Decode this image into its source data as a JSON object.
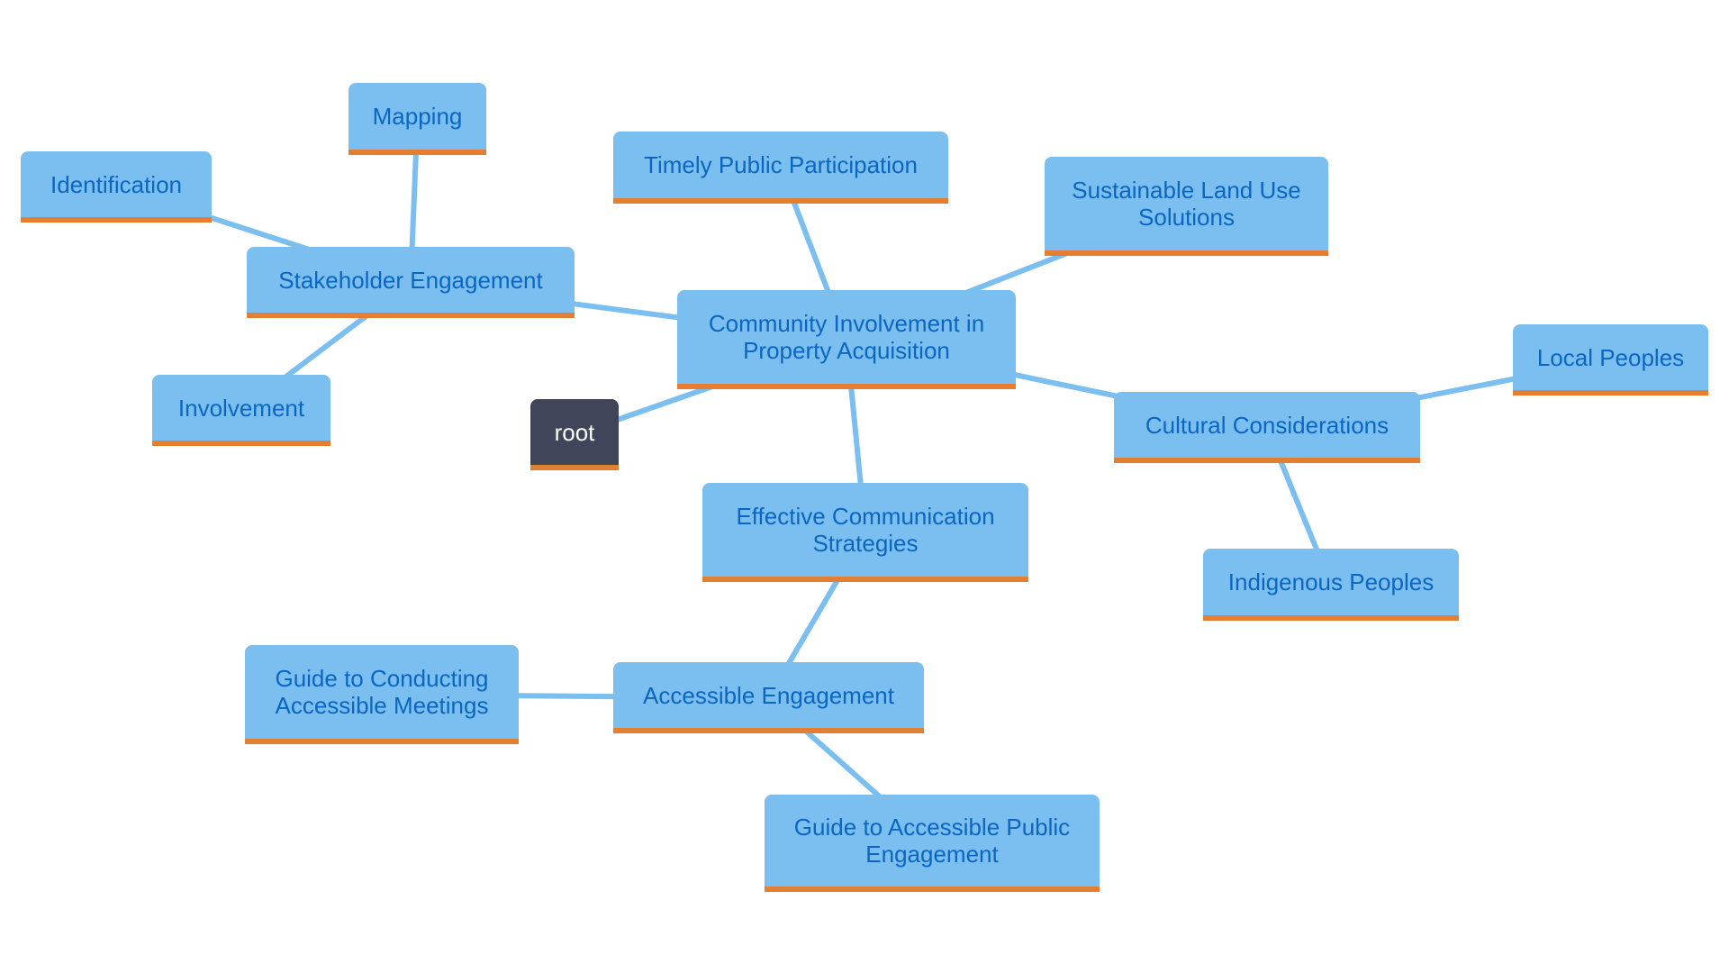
{
  "diagram": {
    "type": "mind-map",
    "colors": {
      "node_fill": "#7bbff0",
      "node_text": "#0a66c2",
      "node_underline": "#e47f31",
      "edge": "#7bbff0",
      "root_fill": "#41455a",
      "root_text": "#ffffff",
      "background": "#ffffff"
    },
    "nodes": [
      {
        "id": "root",
        "label": "root"
      },
      {
        "id": "center",
        "label": "Community Involvement in\nProperty Acquisition"
      },
      {
        "id": "stakeholder",
        "label": "Stakeholder Engagement"
      },
      {
        "id": "identification",
        "label": "Identification"
      },
      {
        "id": "mapping",
        "label": "Mapping"
      },
      {
        "id": "involvement",
        "label": "Involvement"
      },
      {
        "id": "timely",
        "label": "Timely Public Participation"
      },
      {
        "id": "sustainable",
        "label": "Sustainable Land Use\nSolutions"
      },
      {
        "id": "cultural",
        "label": "Cultural Considerations"
      },
      {
        "id": "local",
        "label": "Local Peoples"
      },
      {
        "id": "indigenous",
        "label": "Indigenous Peoples"
      },
      {
        "id": "effective",
        "label": "Effective Communication\nStrategies"
      },
      {
        "id": "accessible",
        "label": "Accessible Engagement"
      },
      {
        "id": "guide_meetings",
        "label": "Guide to Conducting\nAccessible Meetings"
      },
      {
        "id": "guide_public",
        "label": "Guide to Accessible Public\nEngagement"
      }
    ],
    "edges": [
      [
        "root",
        "center"
      ],
      [
        "center",
        "stakeholder"
      ],
      [
        "stakeholder",
        "identification"
      ],
      [
        "stakeholder",
        "mapping"
      ],
      [
        "stakeholder",
        "involvement"
      ],
      [
        "center",
        "timely"
      ],
      [
        "center",
        "sustainable"
      ],
      [
        "center",
        "cultural"
      ],
      [
        "cultural",
        "local"
      ],
      [
        "cultural",
        "indigenous"
      ],
      [
        "center",
        "effective"
      ],
      [
        "effective",
        "accessible"
      ],
      [
        "accessible",
        "guide_meetings"
      ],
      [
        "accessible",
        "guide_public"
      ]
    ]
  }
}
